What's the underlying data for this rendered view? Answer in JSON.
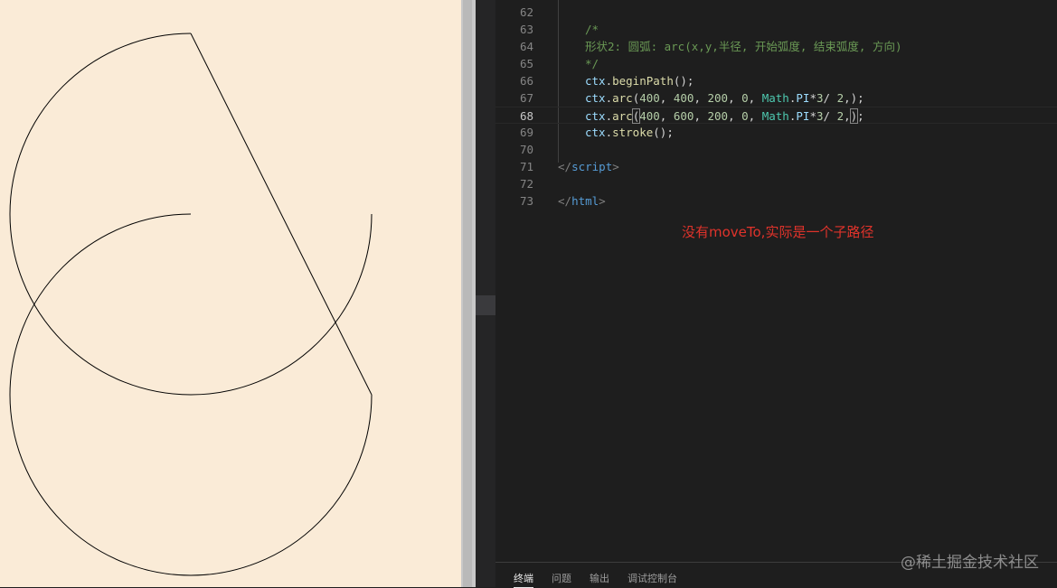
{
  "editor": {
    "lines": [
      {
        "num": "62",
        "tokens": []
      },
      {
        "num": "63",
        "tokens": [
          {
            "t": "/*",
            "c": "t-com"
          }
        ]
      },
      {
        "num": "64",
        "tokens": [
          {
            "t": "形状2: 圆弧: arc(x,y,半径, 开始弧度, 结束弧度, 方向)",
            "c": "t-com"
          }
        ]
      },
      {
        "num": "65",
        "tokens": [
          {
            "t": "*/",
            "c": "t-com"
          }
        ]
      },
      {
        "num": "66",
        "tokens": [
          {
            "t": "ctx",
            "c": "t-var"
          },
          {
            "t": ".",
            "c": ""
          },
          {
            "t": "beginPath",
            "c": "t-fn"
          },
          {
            "t": "();",
            "c": ""
          }
        ]
      },
      {
        "num": "67",
        "tokens": [
          {
            "t": "ctx",
            "c": "t-var"
          },
          {
            "t": ".",
            "c": ""
          },
          {
            "t": "arc",
            "c": "t-fn"
          },
          {
            "t": "(",
            "c": ""
          },
          {
            "t": "400",
            "c": "t-num"
          },
          {
            "t": ", ",
            "c": ""
          },
          {
            "t": "400",
            "c": "t-num"
          },
          {
            "t": ", ",
            "c": ""
          },
          {
            "t": "200",
            "c": "t-num"
          },
          {
            "t": ", ",
            "c": ""
          },
          {
            "t": "0",
            "c": "t-num"
          },
          {
            "t": ", ",
            "c": ""
          },
          {
            "t": "Math",
            "c": "t-cls"
          },
          {
            "t": ".",
            "c": ""
          },
          {
            "t": "PI",
            "c": "t-var"
          },
          {
            "t": "*",
            "c": ""
          },
          {
            "t": "3",
            "c": "t-num"
          },
          {
            "t": "/ ",
            "c": ""
          },
          {
            "t": "2",
            "c": "t-num"
          },
          {
            "t": ",);",
            "c": ""
          }
        ]
      },
      {
        "num": "68",
        "tokens": [
          {
            "t": "ctx",
            "c": "t-var"
          },
          {
            "t": ".",
            "c": ""
          },
          {
            "t": "arc",
            "c": "t-fn"
          },
          {
            "t": "(",
            "c": "cursor-box"
          },
          {
            "t": "400",
            "c": "t-num"
          },
          {
            "t": ", ",
            "c": ""
          },
          {
            "t": "600",
            "c": "t-num"
          },
          {
            "t": ", ",
            "c": ""
          },
          {
            "t": "200",
            "c": "t-num"
          },
          {
            "t": ", ",
            "c": ""
          },
          {
            "t": "0",
            "c": "t-num"
          },
          {
            "t": ", ",
            "c": ""
          },
          {
            "t": "Math",
            "c": "t-cls"
          },
          {
            "t": ".",
            "c": ""
          },
          {
            "t": "PI",
            "c": "t-var"
          },
          {
            "t": "*",
            "c": ""
          },
          {
            "t": "3",
            "c": "t-num"
          },
          {
            "t": "/ ",
            "c": ""
          },
          {
            "t": "2",
            "c": "t-num"
          },
          {
            "t": ",",
            "c": ""
          },
          {
            "t": ")",
            "c": "cursor-box"
          },
          {
            "t": ";",
            "c": ""
          }
        ]
      },
      {
        "num": "69",
        "tokens": [
          {
            "t": "ctx",
            "c": "t-var"
          },
          {
            "t": ".",
            "c": ""
          },
          {
            "t": "stroke",
            "c": "t-fn"
          },
          {
            "t": "();",
            "c": ""
          }
        ]
      },
      {
        "num": "70",
        "tokens": []
      },
      {
        "num": "71",
        "tokens": [
          {
            "t": "</",
            "c": "t-punc"
          },
          {
            "t": "script",
            "c": "t-tag"
          },
          {
            "t": ">",
            "c": "t-punc"
          }
        ]
      },
      {
        "num": "72",
        "tokens": []
      },
      {
        "num": "73",
        "tokens": [
          {
            "t": "</",
            "c": "t-punc"
          },
          {
            "t": "html",
            "c": "t-tag"
          },
          {
            "t": ">",
            "c": "t-punc"
          }
        ]
      }
    ],
    "active_line": "68"
  },
  "annotation": "没有moveTo,实际是一个子路径",
  "panel_tabs": [
    "终端",
    "问题",
    "输出",
    "调试控制台"
  ],
  "active_panel_tab": "终端",
  "watermark": "@稀土掘金技术社区",
  "colors": {
    "canvas_bg": "#faebd7",
    "stroke": "#000000",
    "annotation": "#e0332b"
  }
}
